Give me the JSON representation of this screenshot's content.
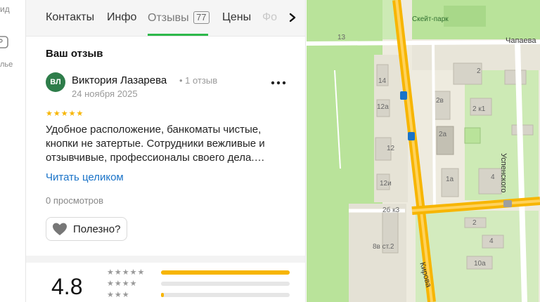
{
  "rail": {
    "top_label": "ид",
    "bottom_label": "лье",
    "icon": "gallery-icon"
  },
  "tabs": [
    {
      "label": "Контакты"
    },
    {
      "label": "Инфо"
    },
    {
      "label": "Отзывы",
      "count": "77",
      "active": true
    },
    {
      "label": "Цены"
    },
    {
      "label": "Фо"
    }
  ],
  "review_section": {
    "title": "Ваш отзыв",
    "avatar_initials": "ВЛ",
    "author": "Виктория Лазарева",
    "author_meta": "• 1 отзыв",
    "date": "24 ноября 2025",
    "stars": 5,
    "text": "Удобное расположение, банкоматы чистые, кнопки не затертые. Сотрудники вежливые и отзывчивые, профессионалы своего дела.…",
    "read_more": "Читать целиком",
    "views": "0 просмотров",
    "useful_label": "Полезно?"
  },
  "rating": {
    "value": "4.8",
    "distribution": [
      {
        "stars": 5,
        "fraction": 1.0
      },
      {
        "stars": 4,
        "fraction": 0.0
      },
      {
        "stars": 3,
        "fraction": 0.02
      }
    ]
  },
  "map": {
    "streets": [
      "Чапаева",
      "Успенского",
      "Кирова"
    ],
    "labels": [
      "Скейт-парк",
      "13",
      "14",
      "12а",
      "12",
      "12и",
      "2б к3",
      "8в ст.2",
      "2",
      "2в",
      "2 к1",
      "2а",
      "1а",
      "4",
      "2",
      "4",
      "10а"
    ],
    "colors": {
      "major_road": "#f7b500",
      "green": "#b9e39a",
      "building": "#d6d3c8"
    }
  }
}
